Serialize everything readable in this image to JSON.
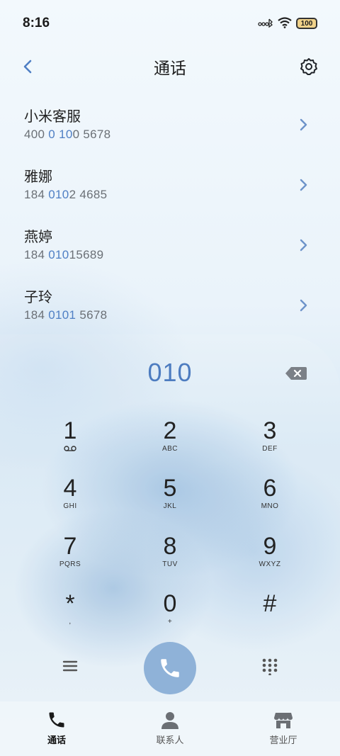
{
  "status_bar": {
    "time": "8:16",
    "battery": "100"
  },
  "header": {
    "title": "通话"
  },
  "contacts": [
    {
      "name": "小米客服",
      "num_pre": "400 ",
      "num_hl": "0 10",
      "num_post": "0 5678"
    },
    {
      "name": "雅娜",
      "num_pre": "184 ",
      "num_hl": "010",
      "num_post": "2 4685"
    },
    {
      "name": "燕婷",
      "num_pre": "184 ",
      "num_hl": "010",
      "num_post": "15689"
    },
    {
      "name": "子玲",
      "num_pre": "184 ",
      "num_hl": "0101",
      "num_post": " 5678"
    }
  ],
  "dialer": {
    "digits": "010",
    "keys": [
      {
        "digit": "1",
        "letters": ""
      },
      {
        "digit": "2",
        "letters": "ABC"
      },
      {
        "digit": "3",
        "letters": "DEF"
      },
      {
        "digit": "4",
        "letters": "GHI"
      },
      {
        "digit": "5",
        "letters": "JKL"
      },
      {
        "digit": "6",
        "letters": "MNO"
      },
      {
        "digit": "7",
        "letters": "PQRS"
      },
      {
        "digit": "8",
        "letters": "TUV"
      },
      {
        "digit": "9",
        "letters": "WXYZ"
      },
      {
        "digit": "*",
        "letters": ","
      },
      {
        "digit": "0",
        "letters": "+"
      },
      {
        "digit": "#",
        "letters": ""
      }
    ]
  },
  "bottom_nav": [
    {
      "label": "通话",
      "icon": "phone-icon",
      "active": true
    },
    {
      "label": "联系人",
      "icon": "person-icon",
      "active": false
    },
    {
      "label": "营业厅",
      "icon": "store-icon",
      "active": false
    }
  ],
  "colors": {
    "accent": "#4f7fc4",
    "call_button": "#8fb2d8"
  }
}
